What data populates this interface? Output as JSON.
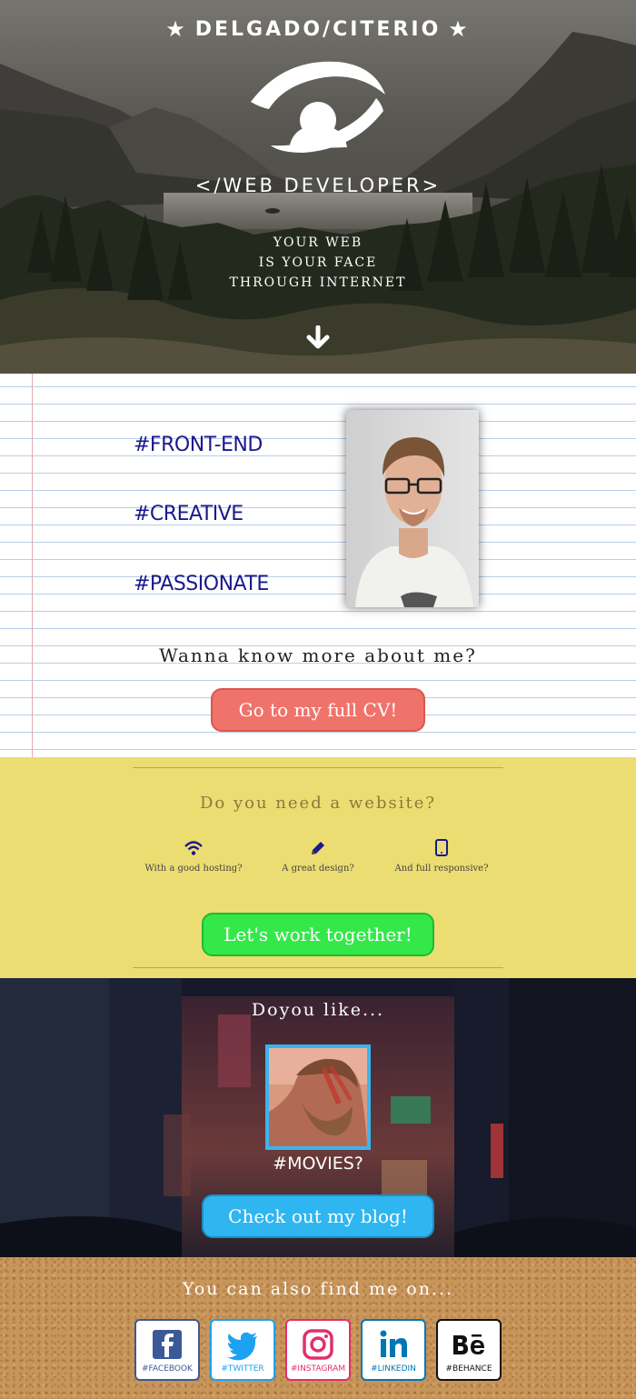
{
  "hero": {
    "brand": "DELGADO/CITERIO",
    "role": "</WEB DEVELOPER>",
    "tagline": [
      "YOUR WEB",
      "IS YOUR FACE",
      "THROUGH INTERNET"
    ],
    "icons": [
      "star-icon",
      "eye-logo-icon",
      "arrow-down-icon"
    ]
  },
  "about": {
    "tags": [
      "#FRONT-END",
      "#CREATIVE",
      "#PASSIONATE"
    ],
    "question": "Wanna know more about me?",
    "cv_button": "Go to my full CV!",
    "colors": {
      "tag": "#1a1a8c",
      "button": "#f0736b"
    }
  },
  "website": {
    "heading": "Do you need a website?",
    "features": [
      {
        "icon": "wifi-icon",
        "label": "With a good hosting?"
      },
      {
        "icon": "pencil-icon",
        "label": "A great design?"
      },
      {
        "icon": "tablet-icon",
        "label": "And full responsive?"
      }
    ],
    "button": "Let's work together!",
    "colors": {
      "background": "#ecdd72",
      "button": "#34e84a"
    }
  },
  "blog": {
    "heading": "Doyou like...",
    "topic": "#MOVIES?",
    "button": "Check out my blog!",
    "colors": {
      "frame": "#3ab5ee",
      "button": "#2fb6f0"
    }
  },
  "social": {
    "heading": "You can also find me on...",
    "links": [
      {
        "icon": "facebook-icon",
        "label": "#FACEBOOK",
        "color": "#3b5998"
      },
      {
        "icon": "twitter-icon",
        "label": "#TWITTER",
        "color": "#1da1f2"
      },
      {
        "icon": "instagram-icon",
        "label": "#INSTAGRAM",
        "color": "#e1306c"
      },
      {
        "icon": "linkedin-icon",
        "label": "#LINKEDIN",
        "color": "#0077b5"
      },
      {
        "icon": "behance-icon",
        "label": "#BEHANCE",
        "color": "#111111"
      }
    ]
  }
}
